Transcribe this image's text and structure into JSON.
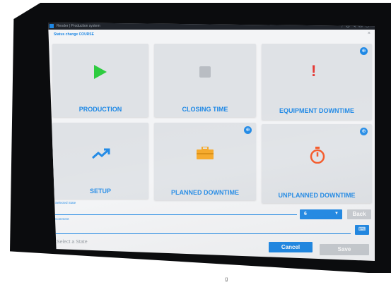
{
  "window": {
    "title": "Reoder | Production system",
    "window_icons": [
      "help-icon",
      "settings-icon",
      "tools-icon",
      "message-icon",
      "user-icon"
    ]
  },
  "dialog": {
    "title": "Status change COURSE",
    "close": "×"
  },
  "tiles": [
    {
      "label": "PRODUCTION",
      "icon": "play-icon",
      "color": "#2ecc40",
      "zoom": false
    },
    {
      "label": "CLOSING TIME",
      "icon": "stop-icon",
      "color": "#b0b4ba",
      "zoom": false
    },
    {
      "label": "EQUIPMENT DOWNTIME",
      "icon": "exclamation-icon",
      "color": "#e53935",
      "zoom": true
    },
    {
      "label": "SETUP",
      "icon": "trending-up-icon",
      "color": "#1e88e5",
      "zoom": false
    },
    {
      "label": "PLANNED DOWNTIME",
      "icon": "toolbox-icon",
      "color": "#f5a623",
      "zoom": true
    },
    {
      "label": "UNPLANNED DOWNTIME",
      "icon": "stopwatch-icon",
      "color": "#f4511e",
      "zoom": true
    }
  ],
  "icons": {
    "exclamation": "!",
    "zoom": "⊕"
  },
  "form": {
    "selected_state_label": "Selected State",
    "comment_label": "Comment",
    "select_value": "6",
    "select_caret": "▼",
    "back_label": "Back",
    "keyboard_glyph": "⌨"
  },
  "footer": {
    "status_text": "Select a State",
    "cancel_label": "Cancel",
    "save_label": "Save"
  },
  "stand_mark": "g",
  "colors": {
    "accent": "#1e88e5",
    "disabled": "#c8ccd1"
  }
}
